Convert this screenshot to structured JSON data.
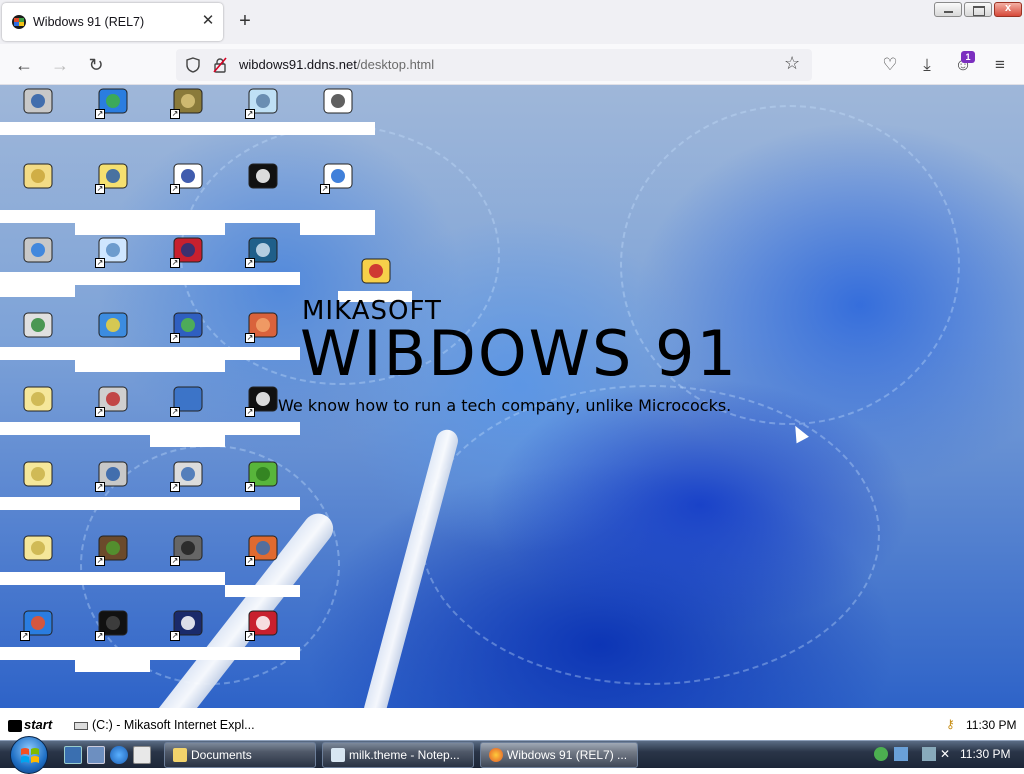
{
  "browser": {
    "tab_title": "Wibdows 91 (REL7)",
    "url_host": "wibdows91.ddns.net",
    "url_path": "/desktop.html",
    "extension_badge": "1"
  },
  "brand": {
    "small": "MIKASOFT",
    "big": "WIBDOWS 91",
    "tagline": "We know how to run a tech company, unlike Micrococks."
  },
  "inner_taskbar": {
    "start_label": "start",
    "task_label": "(C:) - Mikasoft Internet Expl...",
    "clock": "11:30 PM"
  },
  "win7_taskbar": {
    "buttons": [
      {
        "label": "Documents"
      },
      {
        "label": "milk.theme - Notep..."
      },
      {
        "label": "Wibdows 91 (REL7) ..."
      }
    ],
    "clock": "11:30 PM"
  },
  "desktop_icons": [
    {
      "name": "my-computer-icon"
    },
    {
      "name": "globe-icon"
    },
    {
      "name": "money-bag-icon"
    },
    {
      "name": "notepad-icon"
    },
    {
      "name": "document-icon"
    },
    {
      "name": "open-folder-icon"
    },
    {
      "name": "help-icon"
    },
    {
      "name": "window-icon"
    },
    {
      "name": "github-icon"
    },
    {
      "name": "ie-page-icon"
    },
    {
      "name": "network-computer-icon"
    },
    {
      "name": "chat-bubble-icon"
    },
    {
      "name": "us-flag-icon"
    },
    {
      "name": "calculator-icon"
    },
    {
      "name": "recycle-bin-icon"
    },
    {
      "name": "ie-icon"
    },
    {
      "name": "msn-icon"
    },
    {
      "name": "paint-icon"
    },
    {
      "name": "folder-icon"
    },
    {
      "name": "paint-brushes-icon"
    },
    {
      "name": "blue-shape-icon"
    },
    {
      "name": "8-ball-icon"
    },
    {
      "name": "folder-icon"
    },
    {
      "name": "computer-icon"
    },
    {
      "name": "properties-icon"
    },
    {
      "name": "grass-icon"
    },
    {
      "name": "folder-icon"
    },
    {
      "name": "minecraft-icon"
    },
    {
      "name": "gear-icon"
    },
    {
      "name": "users-icon"
    },
    {
      "name": "windows-globe-icon"
    },
    {
      "name": "black-cat-icon"
    },
    {
      "name": "floppy-icon"
    },
    {
      "name": "gift-icon"
    },
    {
      "name": "font-icon"
    }
  ]
}
